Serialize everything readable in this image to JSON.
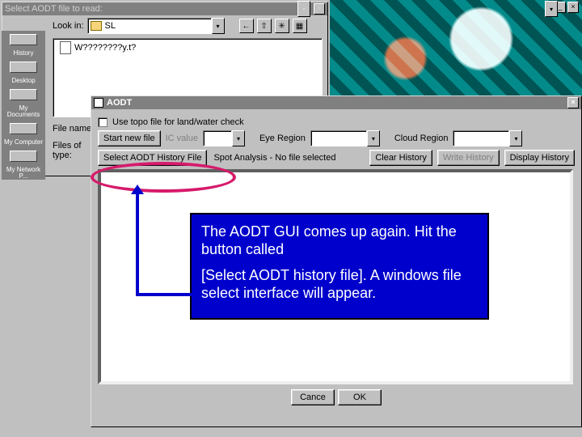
{
  "fileOpen": {
    "title": "Select AODT file to read:",
    "lookin_label": "Look in:",
    "lookin_value": "SL",
    "nav_icons": [
      "back-icon",
      "up-icon",
      "new-folder-icon",
      "views-icon"
    ],
    "sidebar": [
      {
        "label": "History"
      },
      {
        "label": "Desktop"
      },
      {
        "label": "My Documents"
      },
      {
        "label": "My Computer"
      },
      {
        "label": "My Network P..."
      }
    ],
    "list_item": "W????????y.t?",
    "filename_label": "File name:",
    "filetype_label": "Files of type:",
    "filename_value": "",
    "filetype_value": ""
  },
  "aodt": {
    "title": "AODT",
    "topo_label": "Use topo file for land/water check",
    "start_btn": "Start new file",
    "ic_label": "IC value",
    "eye_label": "Eye Region",
    "cloud_label": "Cloud Region",
    "select_hist_btn": "Select AODT History File",
    "status_text": "Spot Analysis - No file selected",
    "clear_btn": "Clear History",
    "write_btn": "Write History",
    "display_btn": "Display History",
    "cancel_btn": "Cance",
    "ok_btn": "OK"
  },
  "instruction": {
    "p1": "The AODT GUI comes up again. Hit the button called",
    "p2": "[Select AODT history file]. A windows file select interface will appear."
  }
}
